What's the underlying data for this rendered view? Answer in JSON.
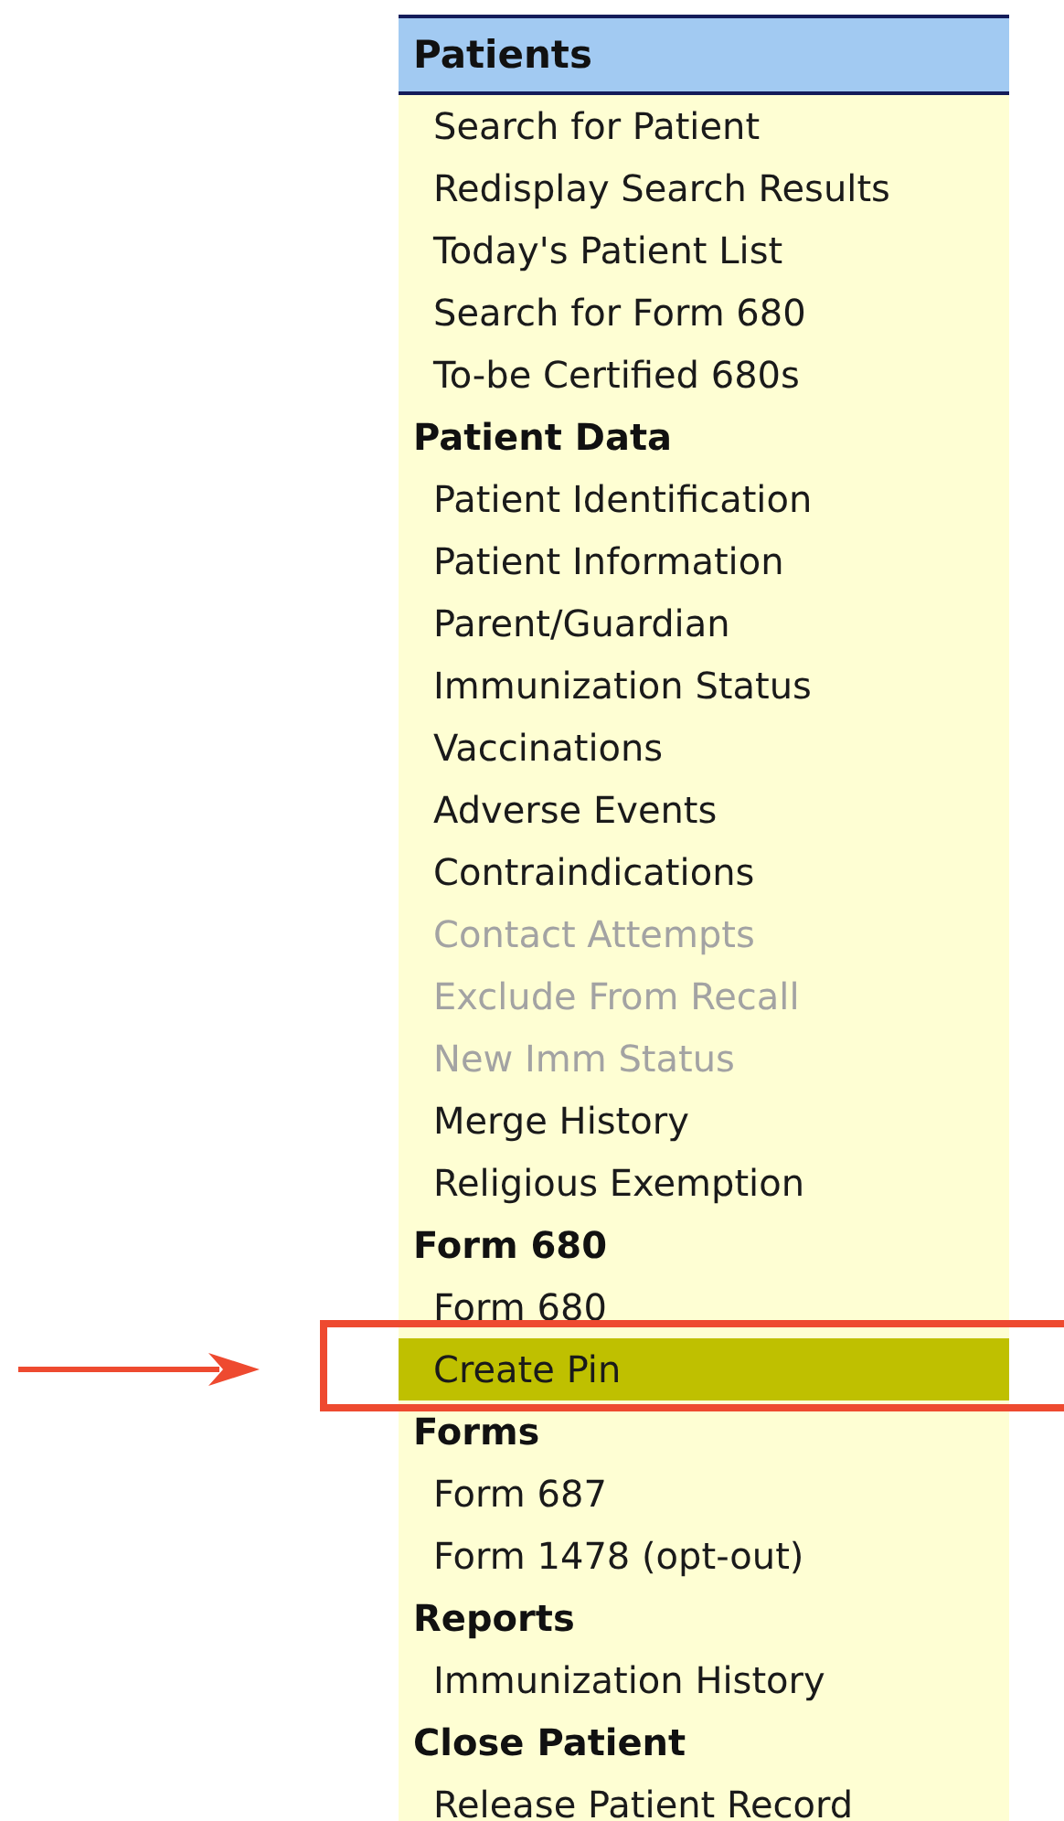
{
  "menu": {
    "sections": [
      {
        "kind": "header",
        "title": "Patients",
        "items": [
          {
            "label": "Search for Patient",
            "disabled": false,
            "selected": false
          },
          {
            "label": "Redisplay Search Results",
            "disabled": false,
            "selected": false
          },
          {
            "label": "Today's Patient List",
            "disabled": false,
            "selected": false
          },
          {
            "label": "Search for Form 680",
            "disabled": false,
            "selected": false
          },
          {
            "label": "To-be Certified 680s",
            "disabled": false,
            "selected": false
          }
        ]
      },
      {
        "kind": "group",
        "title": "Patient Data",
        "items": [
          {
            "label": "Patient Identification",
            "disabled": false,
            "selected": false
          },
          {
            "label": "Patient Information",
            "disabled": false,
            "selected": false
          },
          {
            "label": "Parent/Guardian",
            "disabled": false,
            "selected": false
          },
          {
            "label": "Immunization Status",
            "disabled": false,
            "selected": false
          },
          {
            "label": "Vaccinations",
            "disabled": false,
            "selected": false
          },
          {
            "label": "Adverse Events",
            "disabled": false,
            "selected": false
          },
          {
            "label": "Contraindications",
            "disabled": false,
            "selected": false
          },
          {
            "label": "Contact Attempts",
            "disabled": true,
            "selected": false
          },
          {
            "label": "Exclude From Recall",
            "disabled": true,
            "selected": false
          },
          {
            "label": "New Imm Status",
            "disabled": true,
            "selected": false
          },
          {
            "label": "Merge History",
            "disabled": false,
            "selected": false
          },
          {
            "label": "Religious Exemption",
            "disabled": false,
            "selected": false
          }
        ]
      },
      {
        "kind": "group",
        "title": "Form 680",
        "items": [
          {
            "label": "Form 680",
            "disabled": false,
            "selected": false
          },
          {
            "label": "Create Pin",
            "disabled": false,
            "selected": true
          }
        ]
      },
      {
        "kind": "group",
        "title": "Forms",
        "items": [
          {
            "label": "Form 687",
            "disabled": false,
            "selected": false
          },
          {
            "label": "Form 1478 (opt-out)",
            "disabled": false,
            "selected": false
          }
        ]
      },
      {
        "kind": "group",
        "title": "Reports",
        "items": [
          {
            "label": "Immunization History",
            "disabled": false,
            "selected": false
          }
        ]
      },
      {
        "kind": "group",
        "title": "Close Patient",
        "items": [
          {
            "label": "Release Patient Record",
            "disabled": false,
            "selected": false
          }
        ]
      }
    ]
  }
}
